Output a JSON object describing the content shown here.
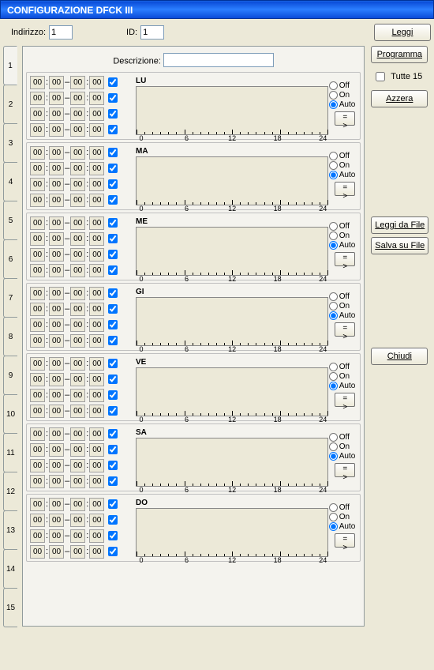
{
  "window": {
    "title": "CONFIGURAZIONE DFCK III"
  },
  "fields": {
    "indirizzo_label": "Indirizzo:",
    "indirizzo_value": "1",
    "id_label": "ID:",
    "id_value": "1",
    "descrizione_label": "Descrizione:",
    "descrizione_value": ""
  },
  "buttons": {
    "leggi": "Leggi",
    "programma": "Programma",
    "azzera": "Azzera",
    "leggi_da_file": "Leggi da File",
    "salva_su_file": "Salva su File",
    "chiudi": "Chiudi",
    "arrow": "= >"
  },
  "checkbox": {
    "tutte15": "Tutte 15"
  },
  "tabs": [
    "1",
    "2",
    "3",
    "4",
    "5",
    "6",
    "7",
    "8",
    "9",
    "10",
    "11",
    "12",
    "13",
    "14",
    "15"
  ],
  "radio_labels": {
    "off": "Off",
    "on": "On",
    "auto": "Auto"
  },
  "axis_ticks": [
    "0",
    "6",
    "12",
    "18",
    "24"
  ],
  "time_sep_colon": ":",
  "time_sep_dash": "–",
  "days": [
    {
      "code": "LU",
      "rows": [
        [
          "00",
          "00",
          "00",
          "00",
          true
        ],
        [
          "00",
          "00",
          "00",
          "00",
          true
        ],
        [
          "00",
          "00",
          "00",
          "00",
          true
        ],
        [
          "00",
          "00",
          "00",
          "00",
          true
        ]
      ],
      "mode": "Auto"
    },
    {
      "code": "MA",
      "rows": [
        [
          "00",
          "00",
          "00",
          "00",
          true
        ],
        [
          "00",
          "00",
          "00",
          "00",
          true
        ],
        [
          "00",
          "00",
          "00",
          "00",
          true
        ],
        [
          "00",
          "00",
          "00",
          "00",
          true
        ]
      ],
      "mode": "Auto"
    },
    {
      "code": "ME",
      "rows": [
        [
          "00",
          "00",
          "00",
          "00",
          true
        ],
        [
          "00",
          "00",
          "00",
          "00",
          true
        ],
        [
          "00",
          "00",
          "00",
          "00",
          true
        ],
        [
          "00",
          "00",
          "00",
          "00",
          true
        ]
      ],
      "mode": "Auto"
    },
    {
      "code": "GI",
      "rows": [
        [
          "00",
          "00",
          "00",
          "00",
          true
        ],
        [
          "00",
          "00",
          "00",
          "00",
          true
        ],
        [
          "00",
          "00",
          "00",
          "00",
          true
        ],
        [
          "00",
          "00",
          "00",
          "00",
          true
        ]
      ],
      "mode": "Auto"
    },
    {
      "code": "VE",
      "rows": [
        [
          "00",
          "00",
          "00",
          "00",
          true
        ],
        [
          "00",
          "00",
          "00",
          "00",
          true
        ],
        [
          "00",
          "00",
          "00",
          "00",
          true
        ],
        [
          "00",
          "00",
          "00",
          "00",
          true
        ]
      ],
      "mode": "Auto"
    },
    {
      "code": "SA",
      "rows": [
        [
          "00",
          "00",
          "00",
          "00",
          true
        ],
        [
          "00",
          "00",
          "00",
          "00",
          true
        ],
        [
          "00",
          "00",
          "00",
          "00",
          true
        ],
        [
          "00",
          "00",
          "00",
          "00",
          true
        ]
      ],
      "mode": "Auto"
    },
    {
      "code": "DO",
      "rows": [
        [
          "00",
          "00",
          "00",
          "00",
          true
        ],
        [
          "00",
          "00",
          "00",
          "00",
          true
        ],
        [
          "00",
          "00",
          "00",
          "00",
          true
        ],
        [
          "00",
          "00",
          "00",
          "00",
          true
        ]
      ],
      "mode": "Auto"
    }
  ]
}
